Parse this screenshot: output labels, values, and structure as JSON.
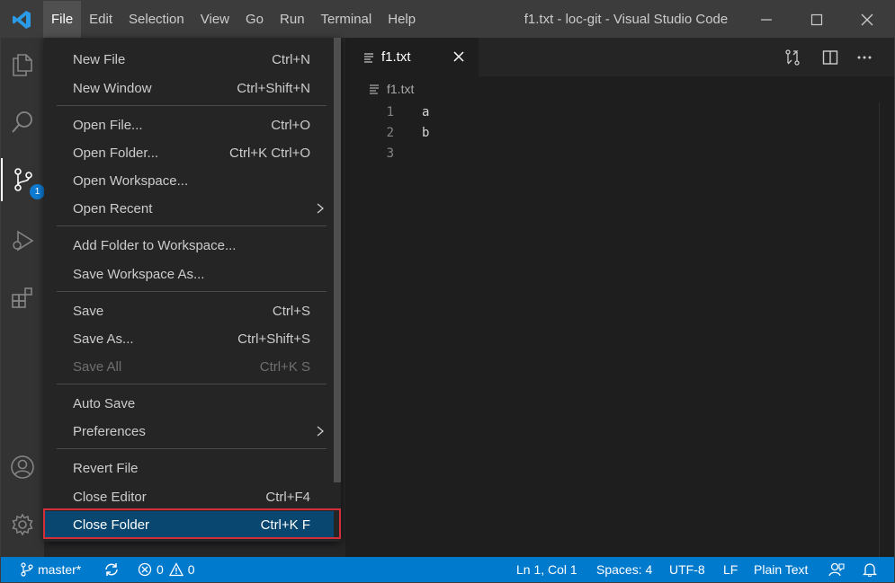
{
  "titlebar": {
    "menus": [
      "File",
      "Edit",
      "Selection",
      "View",
      "Go",
      "Run",
      "Terminal",
      "Help"
    ],
    "title": "f1.txt - loc-git - Visual Studio Code"
  },
  "activity": {
    "badge": "1"
  },
  "file_menu": {
    "new_file": {
      "label": "New File",
      "key": "Ctrl+N"
    },
    "new_window": {
      "label": "New Window",
      "key": "Ctrl+Shift+N"
    },
    "open_file": {
      "label": "Open File...",
      "key": "Ctrl+O"
    },
    "open_folder": {
      "label": "Open Folder...",
      "key": "Ctrl+K Ctrl+O"
    },
    "open_workspace": {
      "label": "Open Workspace..."
    },
    "open_recent": {
      "label": "Open Recent"
    },
    "add_folder": {
      "label": "Add Folder to Workspace..."
    },
    "save_workspace_as": {
      "label": "Save Workspace As..."
    },
    "save": {
      "label": "Save",
      "key": "Ctrl+S"
    },
    "save_as": {
      "label": "Save As...",
      "key": "Ctrl+Shift+S"
    },
    "save_all": {
      "label": "Save All",
      "key": "Ctrl+K S"
    },
    "auto_save": {
      "label": "Auto Save"
    },
    "preferences": {
      "label": "Preferences"
    },
    "revert_file": {
      "label": "Revert File"
    },
    "close_editor": {
      "label": "Close Editor",
      "key": "Ctrl+F4"
    },
    "close_folder": {
      "label": "Close Folder",
      "key": "Ctrl+K F"
    }
  },
  "editor": {
    "tab_label": "f1.txt",
    "breadcrumb": "f1.txt",
    "lines": [
      {
        "num": "1",
        "text": "a"
      },
      {
        "num": "2",
        "text": "b"
      },
      {
        "num": "3",
        "text": ""
      }
    ]
  },
  "statusbar": {
    "branch": "master*",
    "errors": "0",
    "warnings": "0",
    "position": "Ln 1, Col 1",
    "spaces": "Spaces: 4",
    "encoding": "UTF-8",
    "eol": "LF",
    "language": "Plain Text"
  },
  "colors": {
    "accent": "#007acc",
    "menu_selection": "#094771",
    "highlight_border": "#d32f3a"
  }
}
